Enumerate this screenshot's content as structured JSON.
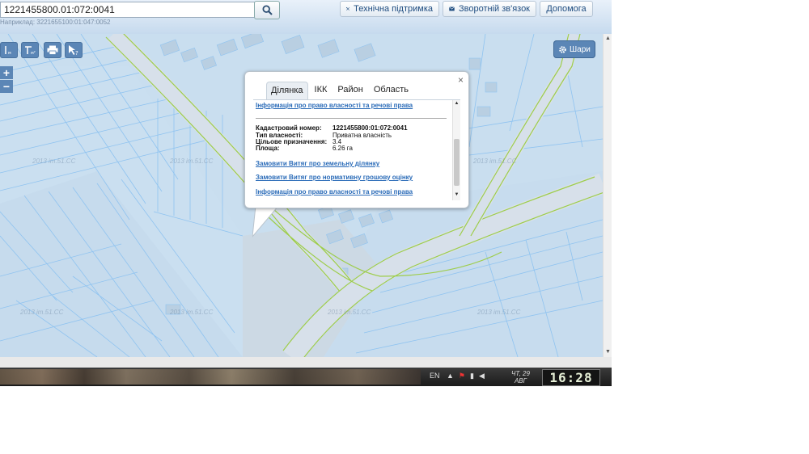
{
  "header": {
    "search_value": "1221455800.01:072:0041",
    "search_example": "Наприклад: 3221655100:01:047:0052",
    "buttons": {
      "support": "Технічна підтримка",
      "feedback": "Зворотній зв'язок",
      "help": "Допомога"
    }
  },
  "map": {
    "layers_button": "Шари",
    "zoom_in": "+",
    "zoom_out": "−",
    "watermark": "2013 im.51.CC",
    "tools": [
      "ruler-length-icon",
      "ruler-area-icon",
      "print-icon",
      "info-pointer-icon"
    ]
  },
  "popup": {
    "tabs": [
      "Ділянка",
      "ІКК",
      "Район",
      "Область"
    ],
    "active_tab": "Ділянка",
    "top_link": "Інформація про право власності та речові права",
    "fields": {
      "cadastral_label": "Кадастровий номер:",
      "cadastral_value": "1221455800:01:072:0041",
      "ownership_label": "Тип власності:",
      "ownership_value": "Приватна власність",
      "purpose_label": "Цільове призначення:",
      "purpose_value": "3.4",
      "area_label": "Площа:",
      "area_value": "6.26 га"
    },
    "links": [
      "Замовити Витяг про земельну ділянку",
      "Замовити Витяг про нормативну грошову оцінку",
      "Інформація про право власності та речові права"
    ],
    "close": "×"
  },
  "taskbar": {
    "language": "EN",
    "day": "ЧТ, 29",
    "month": "АВГ",
    "clock": "16:28"
  }
}
